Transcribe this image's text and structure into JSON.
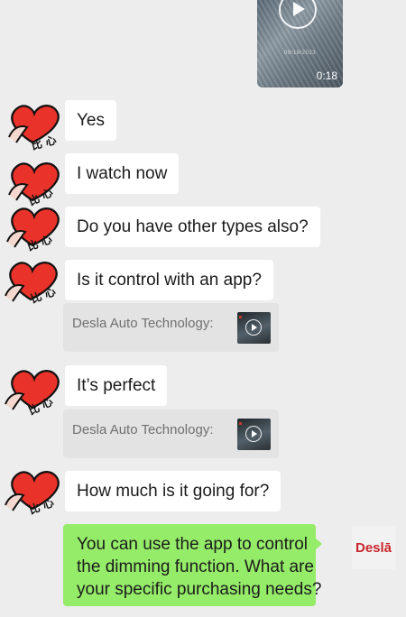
{
  "video": {
    "duration": "0:18",
    "caption_text": "09/19/2023"
  },
  "messages": [
    {
      "text": "Yes"
    },
    {
      "text": "I watch now"
    },
    {
      "text": "Do you have other types also?"
    },
    {
      "text": "Is it control with an app?"
    },
    {
      "text": "It’s perfect"
    },
    {
      "text": "How much is it going for?"
    }
  ],
  "quotes": [
    {
      "text": "Desla Auto Technology:"
    },
    {
      "text": "Desla Auto Technology:"
    }
  ],
  "outgoing": {
    "lines": [
      "You can use the app to control",
      "the dimming function. What are",
      "your specific purchasing needs?"
    ]
  },
  "my_avatar": {
    "label": "Deslā"
  },
  "sticker": {
    "text": "比心",
    "color": "#e8322a"
  }
}
